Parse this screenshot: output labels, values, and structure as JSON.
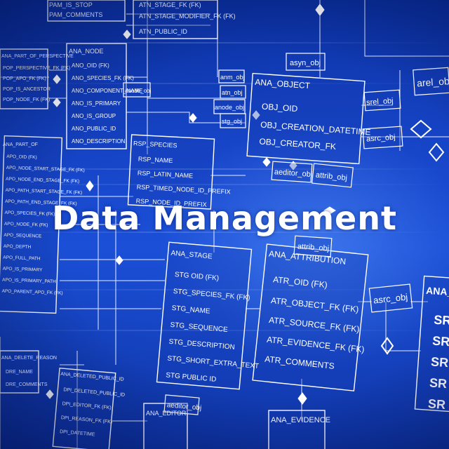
{
  "headline": "Data Management",
  "colors": {
    "background": "#1746c9",
    "line": "#ffffff",
    "text": "#ffffff"
  },
  "entities": [
    {
      "title": "ANA_OBJECT",
      "fields": [
        "OBJ_OID",
        "OBJ_CREATION_DATETIME",
        "OBJ_CREATOR_FK"
      ]
    },
    {
      "title": "ANA_ATTRIBUTION",
      "fields": [
        "ATR_OID (FK)",
        "ATR_OBJECT_FK (FK)",
        "ATR_SOURCE_FK (FK)",
        "ATR_EVIDENCE_FK (FK)",
        "ATR_COMMENTS"
      ]
    },
    {
      "title": "ANA_STAGE",
      "fields": [
        "STG OID (FK)",
        "STG_SPECIES_FK (FK)",
        "STG_NAME",
        "STG_SEQUENCE",
        "STG_DESCRIPTION",
        "STG_SHORT_EXTRA_TEXT",
        "STG PUBLIC ID"
      ]
    },
    {
      "title": "RSP_SPECIES",
      "fields": [
        "RSP_NAME",
        "RSP_LATIN_NAME",
        "RSP_TIMED_NODE_ID_PREFIX",
        "RSP_NODE_ID_PREFIX"
      ]
    },
    {
      "title": "ANA_NODE",
      "fields": [
        "ANO_OID (FK)",
        "ANO_SPECIES_FK (FK)",
        "ANO_COMPONENT_NAME",
        "ANO_IS_PRIMARY",
        "ANO_IS_GROUP",
        "ANO_PUBLIC_ID",
        "ANO_DESCRIPTION"
      ]
    },
    {
      "title": "ANA_PART_OF",
      "fields": [
        "APO_OID (FK)",
        "APO_NODE_START_STAGE_FK (FK)",
        "APO_NODE_END_STAGE_FK (FK)",
        "APO_PATH_START_STAGE_FK (FK)",
        "APO_PATH_END_STAGE_FK (FK)",
        "APO_SPECIES_FK (FK)",
        "APO_NODE_FK (FK)",
        "APO_SEQUENCE",
        "APO_DEPTH",
        "APO_FULL_PATH",
        "APO_IS_PRIMARY",
        "APO_IS_PRIMARY_PATH",
        "APO_PARENT_APO_FK (FK)"
      ]
    },
    {
      "title": "ANA_PART_OF_PERSPECTIVE",
      "fields": [
        "POP_PERSPECTIVE_FK (FK)",
        "POP_APO_FK (FK)",
        "POP_IS_ANCESTOR",
        "POP_NODE_FK (FK)"
      ]
    },
    {
      "title": "ANA_DELETED_PUBLIC_ID",
      "fields": [
        "DPI_DELETED_PUBLIC_ID",
        "DPI_EDITOR_FK (FK)",
        "DPI_REASON_FK (FK)",
        "DPI_DATETIME"
      ]
    },
    {
      "title": "ANA_DELETE_REASON",
      "fields": [
        "DRE_NAME",
        "DRE_COMMENTS"
      ]
    }
  ],
  "top_fields": [
    "PAM_IS_STOP",
    "PAM_COMMENTS"
  ],
  "top_fields_2": [
    "ATN_STAGE_FK (FK)",
    "ATN_STAGE_MODIFIER_FK (FK)",
    "ATN_PUBLIC_ID"
  ],
  "tags": [
    "asyn_obj",
    "anode_obj",
    "anm_obj",
    "atn_obj",
    "anode_obj",
    "stg_obj",
    "srel_obj",
    "arel_obj",
    "asrc_obj",
    "aeditor_obj",
    "attrib_obj",
    "attrib_obj",
    "asrc_obj",
    "aeditor_obj",
    "ANA_EDITOR",
    "ANA_EVIDENCE",
    "ANA_"
  ],
  "partial_right_fields": [
    "SR",
    "SR",
    "SR",
    "SR",
    "SR"
  ]
}
